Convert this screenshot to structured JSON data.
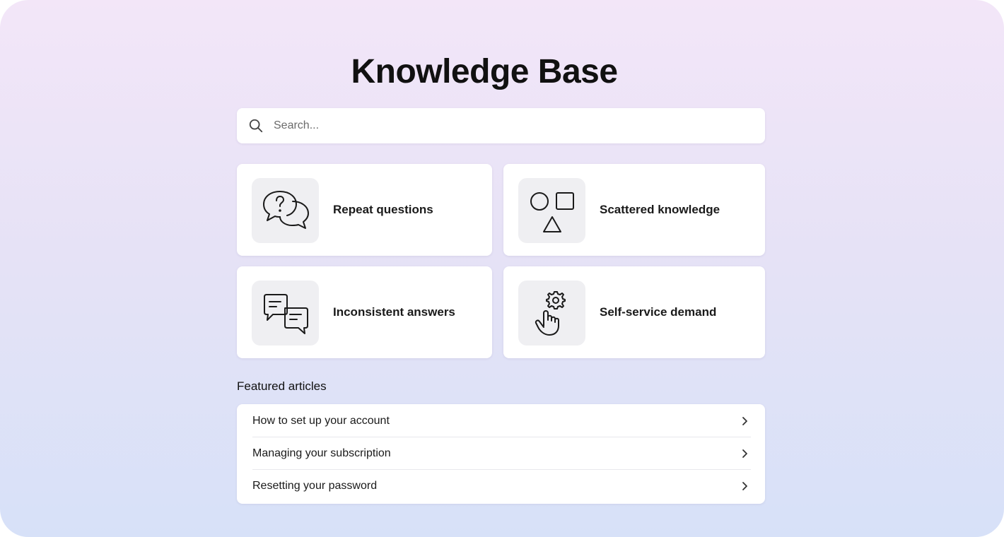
{
  "page": {
    "title": "Knowledge Base"
  },
  "search": {
    "placeholder": "Search...",
    "value": "",
    "icon": "search-icon"
  },
  "cards": [
    {
      "label": "Repeat questions",
      "icon": "question-chat-bubbles-icon"
    },
    {
      "label": "Scattered knowledge",
      "icon": "shapes-icon"
    },
    {
      "label": "Inconsistent answers",
      "icon": "text-chat-bubbles-icon"
    },
    {
      "label": "Self-service demand",
      "icon": "hand-gear-icon"
    }
  ],
  "featured": {
    "heading": "Featured articles",
    "articles": [
      {
        "label": "How to set up your account",
        "icon": "chevron-right-icon"
      },
      {
        "label": "Managing your subscription",
        "icon": "chevron-right-icon"
      },
      {
        "label": "Resetting your password",
        "icon": "chevron-right-icon"
      }
    ]
  },
  "colors": {
    "gradient_top": "#f3e6f8",
    "gradient_bottom": "#d7e1f8",
    "card_background": "#ffffff",
    "icon_tile": "#efeff2",
    "text": "#111111"
  }
}
